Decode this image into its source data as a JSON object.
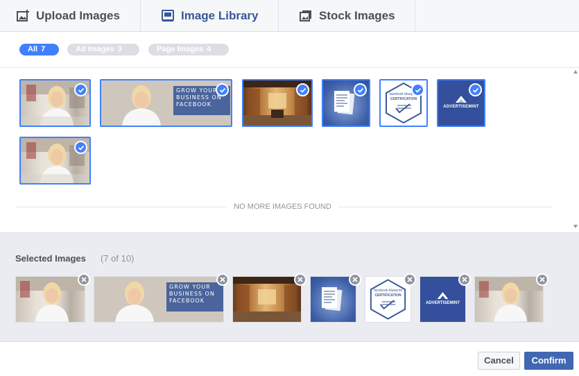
{
  "tabs": [
    {
      "label": "Upload Images",
      "icon": "upload-image-icon",
      "active": false
    },
    {
      "label": "Image Library",
      "icon": "image-library-icon",
      "active": true
    },
    {
      "label": "Stock Images",
      "icon": "stock-images-icon",
      "active": false
    }
  ],
  "filters": [
    {
      "label": "All",
      "count": "7",
      "active": true
    },
    {
      "label": "Ad Images",
      "count": "3",
      "active": false
    },
    {
      "label": "Page Images",
      "count": "4",
      "active": false
    }
  ],
  "library": {
    "empty_message": "NO MORE IMAGES FOUND",
    "banner_text": [
      "GROW YOUR",
      "BUSINESS ON",
      "FACEBOOK"
    ],
    "cert_text": [
      "facebook blueprint",
      "CERTIFICATION"
    ],
    "adv_text": "ADVERTISEMINT"
  },
  "selected": {
    "title": "Selected Images",
    "count": "(7 of 10)"
  },
  "footer": {
    "cancel_label": "Cancel",
    "confirm_label": "Confirm"
  },
  "colors": {
    "accent": "#4080ff",
    "brand": "#4267b2",
    "active_tab": "#365899"
  }
}
